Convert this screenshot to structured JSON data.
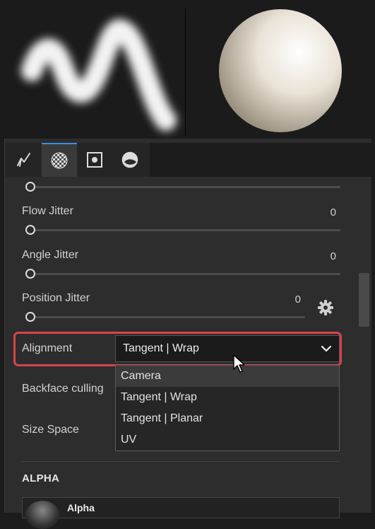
{
  "preview": {
    "brush_stroke_icon": "brush-stroke-preview",
    "material_sphere_icon": "material-sphere-preview"
  },
  "tabs": [
    {
      "icon": "brush-icon",
      "active": false
    },
    {
      "icon": "checker-icon",
      "active": true
    },
    {
      "icon": "stencil-icon",
      "active": false
    },
    {
      "icon": "material-icon",
      "active": false
    }
  ],
  "params": {
    "flow_jitter": {
      "label": "Flow Jitter",
      "value": "0"
    },
    "angle_jitter": {
      "label": "Angle Jitter",
      "value": "0"
    },
    "position_jitter": {
      "label": "Position Jitter",
      "value": "0"
    }
  },
  "alignment": {
    "label": "Alignment",
    "selected": "Tangent | Wrap",
    "options": [
      "Camera",
      "Tangent | Wrap",
      "Tangent | Planar",
      "UV"
    ],
    "highlighted_option": "Camera"
  },
  "backface": {
    "label": "Backface culling"
  },
  "size_space": {
    "label": "Size Space"
  },
  "alpha_section": {
    "title": "ALPHA",
    "item_label": "Alpha"
  },
  "colors": {
    "accent": "#3d8ee0",
    "highlight": "#d9434a"
  }
}
